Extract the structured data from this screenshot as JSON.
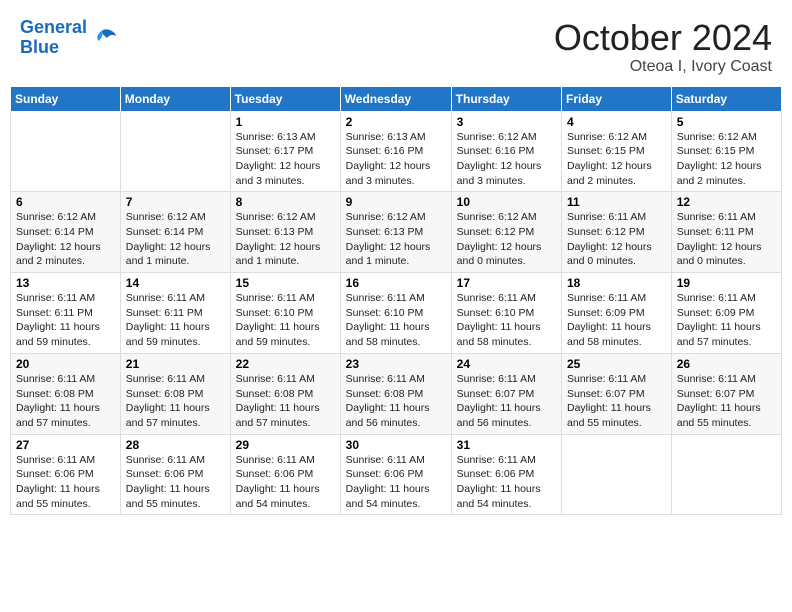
{
  "header": {
    "logo_line1": "General",
    "logo_line2": "Blue",
    "month": "October 2024",
    "location": "Oteoa I, Ivory Coast"
  },
  "weekdays": [
    "Sunday",
    "Monday",
    "Tuesday",
    "Wednesday",
    "Thursday",
    "Friday",
    "Saturday"
  ],
  "weeks": [
    [
      {
        "day": "",
        "text": ""
      },
      {
        "day": "",
        "text": ""
      },
      {
        "day": "1",
        "text": "Sunrise: 6:13 AM\nSunset: 6:17 PM\nDaylight: 12 hours and 3 minutes."
      },
      {
        "day": "2",
        "text": "Sunrise: 6:13 AM\nSunset: 6:16 PM\nDaylight: 12 hours and 3 minutes."
      },
      {
        "day": "3",
        "text": "Sunrise: 6:12 AM\nSunset: 6:16 PM\nDaylight: 12 hours and 3 minutes."
      },
      {
        "day": "4",
        "text": "Sunrise: 6:12 AM\nSunset: 6:15 PM\nDaylight: 12 hours and 2 minutes."
      },
      {
        "day": "5",
        "text": "Sunrise: 6:12 AM\nSunset: 6:15 PM\nDaylight: 12 hours and 2 minutes."
      }
    ],
    [
      {
        "day": "6",
        "text": "Sunrise: 6:12 AM\nSunset: 6:14 PM\nDaylight: 12 hours and 2 minutes."
      },
      {
        "day": "7",
        "text": "Sunrise: 6:12 AM\nSunset: 6:14 PM\nDaylight: 12 hours and 1 minute."
      },
      {
        "day": "8",
        "text": "Sunrise: 6:12 AM\nSunset: 6:13 PM\nDaylight: 12 hours and 1 minute."
      },
      {
        "day": "9",
        "text": "Sunrise: 6:12 AM\nSunset: 6:13 PM\nDaylight: 12 hours and 1 minute."
      },
      {
        "day": "10",
        "text": "Sunrise: 6:12 AM\nSunset: 6:12 PM\nDaylight: 12 hours and 0 minutes."
      },
      {
        "day": "11",
        "text": "Sunrise: 6:11 AM\nSunset: 6:12 PM\nDaylight: 12 hours and 0 minutes."
      },
      {
        "day": "12",
        "text": "Sunrise: 6:11 AM\nSunset: 6:11 PM\nDaylight: 12 hours and 0 minutes."
      }
    ],
    [
      {
        "day": "13",
        "text": "Sunrise: 6:11 AM\nSunset: 6:11 PM\nDaylight: 11 hours and 59 minutes."
      },
      {
        "day": "14",
        "text": "Sunrise: 6:11 AM\nSunset: 6:11 PM\nDaylight: 11 hours and 59 minutes."
      },
      {
        "day": "15",
        "text": "Sunrise: 6:11 AM\nSunset: 6:10 PM\nDaylight: 11 hours and 59 minutes."
      },
      {
        "day": "16",
        "text": "Sunrise: 6:11 AM\nSunset: 6:10 PM\nDaylight: 11 hours and 58 minutes."
      },
      {
        "day": "17",
        "text": "Sunrise: 6:11 AM\nSunset: 6:10 PM\nDaylight: 11 hours and 58 minutes."
      },
      {
        "day": "18",
        "text": "Sunrise: 6:11 AM\nSunset: 6:09 PM\nDaylight: 11 hours and 58 minutes."
      },
      {
        "day": "19",
        "text": "Sunrise: 6:11 AM\nSunset: 6:09 PM\nDaylight: 11 hours and 57 minutes."
      }
    ],
    [
      {
        "day": "20",
        "text": "Sunrise: 6:11 AM\nSunset: 6:08 PM\nDaylight: 11 hours and 57 minutes."
      },
      {
        "day": "21",
        "text": "Sunrise: 6:11 AM\nSunset: 6:08 PM\nDaylight: 11 hours and 57 minutes."
      },
      {
        "day": "22",
        "text": "Sunrise: 6:11 AM\nSunset: 6:08 PM\nDaylight: 11 hours and 57 minutes."
      },
      {
        "day": "23",
        "text": "Sunrise: 6:11 AM\nSunset: 6:08 PM\nDaylight: 11 hours and 56 minutes."
      },
      {
        "day": "24",
        "text": "Sunrise: 6:11 AM\nSunset: 6:07 PM\nDaylight: 11 hours and 56 minutes."
      },
      {
        "day": "25",
        "text": "Sunrise: 6:11 AM\nSunset: 6:07 PM\nDaylight: 11 hours and 55 minutes."
      },
      {
        "day": "26",
        "text": "Sunrise: 6:11 AM\nSunset: 6:07 PM\nDaylight: 11 hours and 55 minutes."
      }
    ],
    [
      {
        "day": "27",
        "text": "Sunrise: 6:11 AM\nSunset: 6:06 PM\nDaylight: 11 hours and 55 minutes."
      },
      {
        "day": "28",
        "text": "Sunrise: 6:11 AM\nSunset: 6:06 PM\nDaylight: 11 hours and 55 minutes."
      },
      {
        "day": "29",
        "text": "Sunrise: 6:11 AM\nSunset: 6:06 PM\nDaylight: 11 hours and 54 minutes."
      },
      {
        "day": "30",
        "text": "Sunrise: 6:11 AM\nSunset: 6:06 PM\nDaylight: 11 hours and 54 minutes."
      },
      {
        "day": "31",
        "text": "Sunrise: 6:11 AM\nSunset: 6:06 PM\nDaylight: 11 hours and 54 minutes."
      },
      {
        "day": "",
        "text": ""
      },
      {
        "day": "",
        "text": ""
      }
    ]
  ]
}
